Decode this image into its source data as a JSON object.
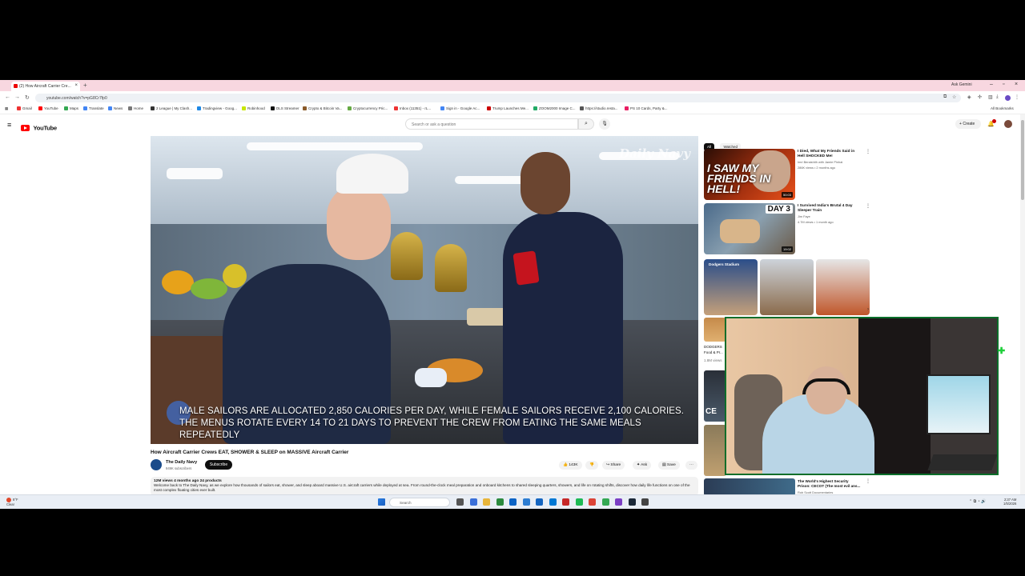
{
  "browser": {
    "tab_title": "(2) How Aircraft Carrier Cre...",
    "new_tab": "+",
    "ask_google": "Ask Gemini",
    "url": "youtube.com/watch?v=pG8Cr7fp0",
    "all_bookmarks": "All Bookmarks",
    "bookmarks": [
      "Gmail",
      "YouTube",
      "Maps",
      "Translate",
      "News",
      "Home",
      "2 League | My Clash...",
      "Tradingview - Goog...",
      "Robinhood",
      "DLS Streamer",
      "Crypto & Bitcoin Va...",
      "Cryptocurrency Pric...",
      "Inbox (11351) - rL...",
      "Sign in - Google Ac...",
      "Trump Launches Me...",
      "ZOOM2000 Image C...",
      "https://studio.resta...",
      "PS 10 Cards, Party &..."
    ]
  },
  "youtube": {
    "logo_text": "YouTube",
    "search_placeholder": "Search or ask a question",
    "create_label": "Create"
  },
  "video": {
    "watermark": "Daily Navy",
    "subtitle": "MALE SAILORS ARE ALLOCATED 2,850 CALORIES PER DAY, WHILE FEMALE SAILORS RECEIVE 2,100 CALORIES. THE MENUS ROTATE EVERY 14 TO 21 DAYS TO PREVENT THE CREW FROM EATING THE SAME MEALS REPEATEDLY",
    "title": "How Aircraft Carrier Crews EAT, SHOWER & SLEEP on MASSIVE Aircraft Carrier",
    "channel": "The Daily Navy",
    "channel_subs": "949K subscribers",
    "subscribe": "Subscribe",
    "likes": "143K",
    "share": "Share",
    "ask": "Ask",
    "save": "Save",
    "desc_meta": "12M views  4 months ago  24 products",
    "desc_text": "Welcome back to The Daily Navy, as we explore how thousands of sailors eat, shower, and sleep aboard massive U.S. aircraft carriers while deployed at sea. From round-the-clock meal preparation and onboard kitchens to shared sleeping quarters, showers, and life on rotating shifts, discover how daily life functions on one of the most complex floating cities ever built."
  },
  "sidebar": {
    "chips": [
      "All",
      "Watched"
    ],
    "recs": [
      {
        "title": "I Died, What My Friends Said in Hell SHOCKED Me!",
        "channel": "Imri Beraishith with Jamie Pinhal",
        "meta": "286K views • 2 months ago",
        "duration": "50:03",
        "overlay": "I SAW MY FRIENDS IN HELL!"
      },
      {
        "title": "I Survived India's Brutal 4 Day Sleeper Train",
        "channel": "Jim Faye",
        "meta": "4.7M views • 1 month ago",
        "duration": "19:02",
        "overlay": "DAY 3"
      }
    ],
    "shorts_label": "Dodgers Stadium",
    "partial_text_1": "DODGERS",
    "partial_text_2": "Food & Pr...",
    "partial_text_3": "1.8M views",
    "partial_text_4": "CE",
    "bottom_title": "The World's Highest Security Prison: CECOT (The most evil ans...",
    "bottom_channel": "Rob Scott Documentaries"
  },
  "taskbar": {
    "weather_temp": "8°F",
    "weather_cond": "Clear",
    "search": "Search",
    "time": "2:37 AM",
    "date": "1/5/2026"
  },
  "colors": {
    "youtube_red": "#ff0000",
    "tabstrip": "#f8d7e0",
    "cam_border": "#0b6e2a"
  }
}
